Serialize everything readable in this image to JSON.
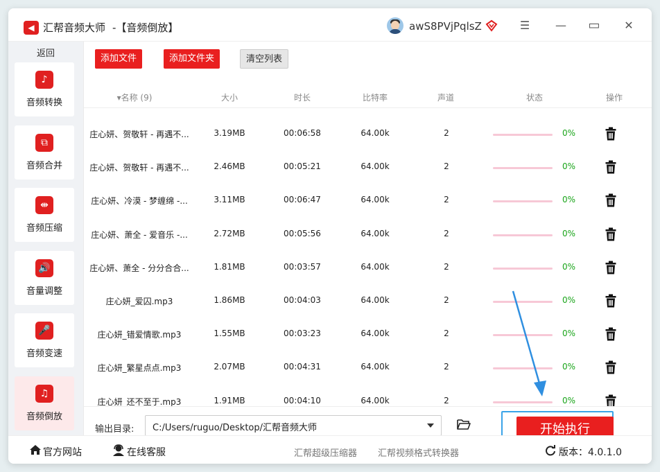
{
  "titlebar": {
    "app_title": "汇帮音频大师",
    "subtitle": "-【音频倒放】",
    "username": "awS8PVjPqlsZ",
    "menu_glyph": "☰",
    "minimize_glyph": "—",
    "maximize_glyph": "▭",
    "close_glyph": "✕"
  },
  "sidebar": {
    "back": "返回",
    "items": [
      {
        "label": "音频转换",
        "icon": "music-convert-icon",
        "glyph": "♪"
      },
      {
        "label": "音频合并",
        "icon": "merge-icon",
        "glyph": "⧉"
      },
      {
        "label": "音频压缩",
        "icon": "compress-icon",
        "glyph": "⇼"
      },
      {
        "label": "音量调整",
        "icon": "volume-icon",
        "glyph": "🔊"
      },
      {
        "label": "音频变速",
        "icon": "microphone-icon",
        "glyph": "🎤"
      },
      {
        "label": "音频倒放",
        "icon": "music-note-icon",
        "glyph": "♫",
        "active": true
      }
    ]
  },
  "toolbar": {
    "add_file": "添加文件",
    "add_folder": "添加文件夹",
    "clear_list": "清空列表"
  },
  "table": {
    "headers": {
      "name": "▾名称 (9)",
      "size": "大小",
      "duration": "时长",
      "bitrate": "比特率",
      "channels": "声道",
      "status": "状态",
      "action": "操作"
    },
    "rows": [
      {
        "name": "庄心妍、贺敬轩 - 再遇不...",
        "size": "3.19MB",
        "duration": "00:06:58",
        "bitrate": "64.00k",
        "channels": "2",
        "status": "0%",
        "progress": 0
      },
      {
        "name": "庄心妍、贺敬轩 - 再遇不...",
        "size": "2.46MB",
        "duration": "00:05:21",
        "bitrate": "64.00k",
        "channels": "2",
        "status": "0%",
        "progress": 0
      },
      {
        "name": "庄心妍、冷漠 - 梦缠绵 -...",
        "size": "3.11MB",
        "duration": "00:06:47",
        "bitrate": "64.00k",
        "channels": "2",
        "status": "0%",
        "progress": 0
      },
      {
        "name": "庄心妍、萧全 - 爱音乐 -...",
        "size": "2.72MB",
        "duration": "00:05:56",
        "bitrate": "64.00k",
        "channels": "2",
        "status": "0%",
        "progress": 0
      },
      {
        "name": "庄心妍、萧全 - 分分合合...",
        "size": "1.81MB",
        "duration": "00:03:57",
        "bitrate": "64.00k",
        "channels": "2",
        "status": "0%",
        "progress": 0
      },
      {
        "name": "庄心妍_爱囚.mp3",
        "size": "1.86MB",
        "duration": "00:04:03",
        "bitrate": "64.00k",
        "channels": "2",
        "status": "0%",
        "progress": 0
      },
      {
        "name": "庄心妍_错爱情歌.mp3",
        "size": "1.55MB",
        "duration": "00:03:23",
        "bitrate": "64.00k",
        "channels": "2",
        "status": "0%",
        "progress": 0
      },
      {
        "name": "庄心妍_繁星点点.mp3",
        "size": "2.07MB",
        "duration": "00:04:31",
        "bitrate": "64.00k",
        "channels": "2",
        "status": "0%",
        "progress": 0
      },
      {
        "name": "庄心妍_还不至于.mp3",
        "size": "1.91MB",
        "duration": "00:04:10",
        "bitrate": "64.00k",
        "channels": "2",
        "status": "0%",
        "progress": 0
      }
    ]
  },
  "output": {
    "label": "输出目录:",
    "path": "C:/Users/ruguo/Desktop/汇帮音频大师"
  },
  "start_button": "开始执行",
  "statusbar": {
    "website": "官方网站",
    "support": "在线客服",
    "link1": "汇帮超级压缩器",
    "link2": "汇帮视频格式转换器",
    "version": "版本：4.0.1.0"
  },
  "colors": {
    "accent_red": "#e91f1f",
    "progress_green": "#1aa51a",
    "highlight_blue": "#3aa3e8"
  }
}
